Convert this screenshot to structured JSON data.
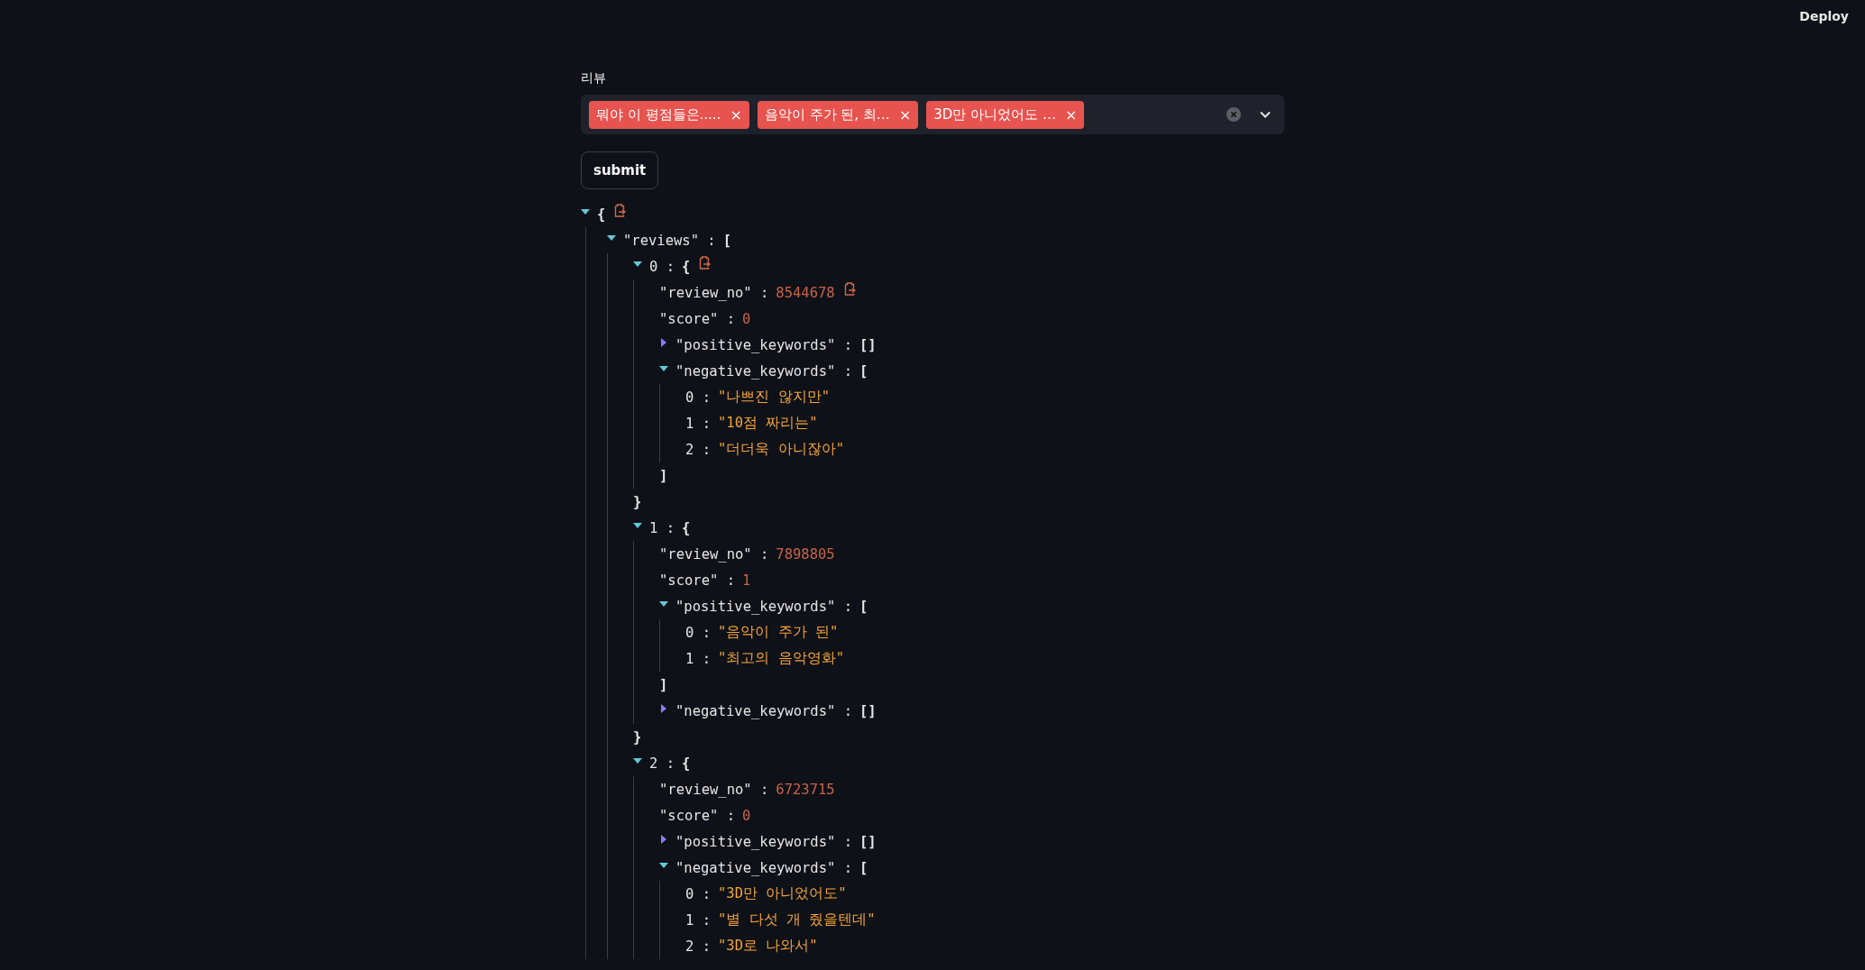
{
  "header": {
    "deploy": "Deploy"
  },
  "field": {
    "label": "리뷰",
    "tags": [
      {
        "text": "뭐야 이 평점들은.....",
        "remove": "×"
      },
      {
        "text": "음악이 주가 된, 최…",
        "remove": "×"
      },
      {
        "text": "3D만 아니었어도 …",
        "remove": "×"
      }
    ]
  },
  "submit": "submit",
  "tree": {
    "kind": "object",
    "open": "{",
    "expanded": true,
    "copy": true,
    "children": [
      {
        "key": "\"reviews\" :",
        "kind": "array",
        "open": "[",
        "expanded": true,
        "children": [
          {
            "key": "0 :",
            "kind": "object",
            "open": "{",
            "expanded": true,
            "copy": true,
            "close": "}",
            "children": [
              {
                "key": "\"review_no\" :",
                "kind": "number",
                "value": "8544678",
                "copy": true
              },
              {
                "key": "\"score\" :",
                "kind": "number",
                "value": "0"
              },
              {
                "key": "\"positive_keywords\" :",
                "kind": "array",
                "expanded": false,
                "value": "[]"
              },
              {
                "key": "\"negative_keywords\" :",
                "kind": "array",
                "open": "[",
                "expanded": true,
                "close": "]",
                "children": [
                  {
                    "key": "0 :",
                    "kind": "string",
                    "value": "\"나쁘진 않지만\""
                  },
                  {
                    "key": "1 :",
                    "kind": "string",
                    "value": "\"10점 짜리는\""
                  },
                  {
                    "key": "2 :",
                    "kind": "string",
                    "value": "\"더더욱 아니잖아\""
                  }
                ]
              }
            ]
          },
          {
            "key": "1 :",
            "kind": "object",
            "open": "{",
            "expanded": true,
            "close": "}",
            "children": [
              {
                "key": "\"review_no\" :",
                "kind": "number",
                "value": "7898805"
              },
              {
                "key": "\"score\" :",
                "kind": "number",
                "value": "1"
              },
              {
                "key": "\"positive_keywords\" :",
                "kind": "array",
                "open": "[",
                "expanded": true,
                "close": "]",
                "children": [
                  {
                    "key": "0 :",
                    "kind": "string",
                    "value": "\"음악이 주가 된\""
                  },
                  {
                    "key": "1 :",
                    "kind": "string",
                    "value": "\"최고의 음악영화\""
                  }
                ]
              },
              {
                "key": "\"negative_keywords\" :",
                "kind": "array",
                "expanded": false,
                "value": "[]"
              }
            ]
          },
          {
            "key": "2 :",
            "kind": "object",
            "open": "{",
            "expanded": true,
            "children": [
              {
                "key": "\"review_no\" :",
                "kind": "number",
                "value": "6723715"
              },
              {
                "key": "\"score\" :",
                "kind": "number",
                "value": "0"
              },
              {
                "key": "\"positive_keywords\" :",
                "kind": "array",
                "expanded": false,
                "value": "[]"
              },
              {
                "key": "\"negative_keywords\" :",
                "kind": "array",
                "open": "[",
                "expanded": true,
                "children": [
                  {
                    "key": "0 :",
                    "kind": "string",
                    "value": "\"3D만 아니었어도\""
                  },
                  {
                    "key": "1 :",
                    "kind": "string",
                    "value": "\"별 다섯 개 줬을텐데\""
                  },
                  {
                    "key": "2 :",
                    "kind": "string",
                    "value": "\"3D로 나와서\""
                  }
                ]
              }
            ]
          }
        ]
      }
    ]
  }
}
